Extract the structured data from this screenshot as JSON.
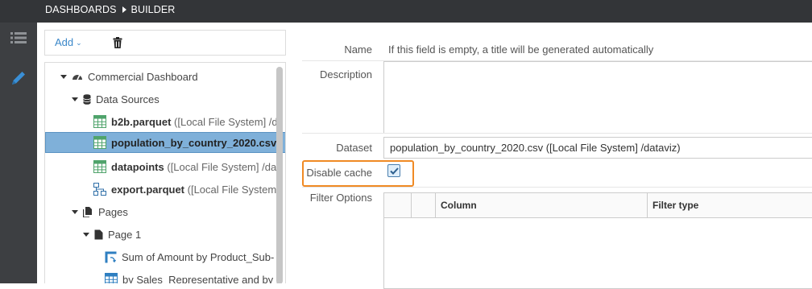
{
  "breadcrumb": {
    "items": [
      "DASHBOARDS",
      "BUILDER"
    ]
  },
  "rail": {
    "icons": [
      "list-icon",
      "pencil-icon"
    ]
  },
  "toolbar": {
    "add_label": "Add"
  },
  "tree": {
    "root": "Commercial Dashboard",
    "data_sources_label": "Data Sources",
    "sources": [
      {
        "name": "b2b.parquet",
        "detail": "([Local File System] /d",
        "icon": "table-icon"
      },
      {
        "name": "population_by_country_2020.csv",
        "detail": "",
        "icon": "table-icon",
        "selected": true
      },
      {
        "name": "datapoints",
        "detail": "([Local File System] /da",
        "icon": "table-icon"
      },
      {
        "name": "export.parquet",
        "detail": "([Local File System",
        "icon": "flow-icon"
      }
    ],
    "pages_label": "Pages",
    "page1_label": "Page 1",
    "widgets": [
      {
        "name": "Sum of Amount by Product_Sub-",
        "icon": "pivot-icon"
      },
      {
        "name": "by Sales_Representative and by F",
        "icon": "table-icon"
      }
    ]
  },
  "form": {
    "name_label": "Name",
    "name_placeholder": "If this field is empty, a title will be generated automatically",
    "description_label": "Description",
    "dataset_label": "Dataset",
    "dataset_value": "population_by_country_2020.csv ([Local File System] /dataviz)",
    "disable_cache_label": "Disable cache",
    "disable_cache_checked": true,
    "filter_options_label": "Filter Options",
    "filter_columns": [
      "Column",
      "Filter type"
    ]
  },
  "colors": {
    "highlight": "#f08a24",
    "selection": "#7fb0d9",
    "link": "#3a87c9"
  }
}
